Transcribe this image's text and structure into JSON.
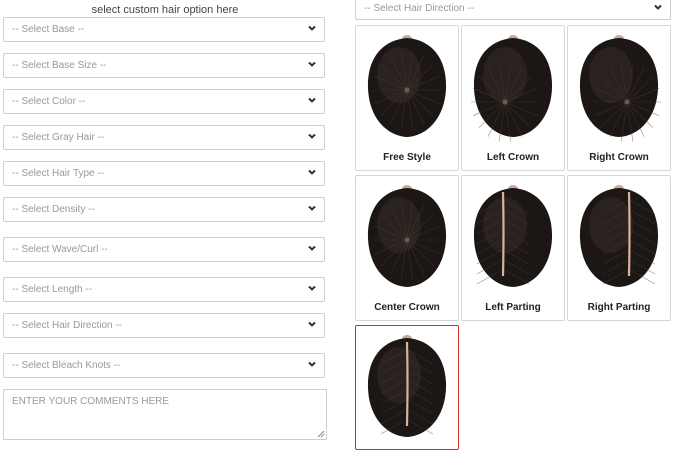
{
  "heading": "select custom hair option here",
  "selects": [
    {
      "key": "base",
      "value": "-- Select Base --"
    },
    {
      "key": "base-size",
      "value": "-- Select Base Size --"
    },
    {
      "key": "color",
      "value": "-- Select Color --"
    },
    {
      "key": "gray-hair",
      "value": "-- Select Gray Hair --"
    },
    {
      "key": "hair-type",
      "value": "-- Select Hair Type --"
    },
    {
      "key": "density",
      "value": "-- Select Density --"
    },
    {
      "key": "wave-curl",
      "value": "-- Select Wave/Curl --"
    },
    {
      "key": "length",
      "value": "-- Select Length --"
    },
    {
      "key": "hair-direction",
      "value": "-- Select Hair Direction --"
    },
    {
      "key": "bleach-knots",
      "value": "-- Select Bleach Knots --"
    }
  ],
  "comments": {
    "placeholder": "ENTER YOUR COMMENTS HERE"
  },
  "direction_select": {
    "value": "-- Select Hair Direction --"
  },
  "direction_options": [
    {
      "label": "Free Style",
      "style": "free"
    },
    {
      "label": "Left Crown",
      "style": "left-crown"
    },
    {
      "label": "Right Crown",
      "style": "right-crown"
    },
    {
      "label": "Center Crown",
      "style": "center-crown"
    },
    {
      "label": "Left Parting",
      "style": "left-part"
    },
    {
      "label": "Right Parting",
      "style": "right-part"
    },
    {
      "label": "",
      "style": "center-part",
      "selected": true
    }
  ],
  "colors": {
    "border": "#cfcfcf",
    "selected_border": "#d42b2b",
    "hair": "#1c1714"
  },
  "icons": {
    "select_arrow": "chevron-down-icon",
    "textarea_grip": "resize-grip-icon"
  }
}
